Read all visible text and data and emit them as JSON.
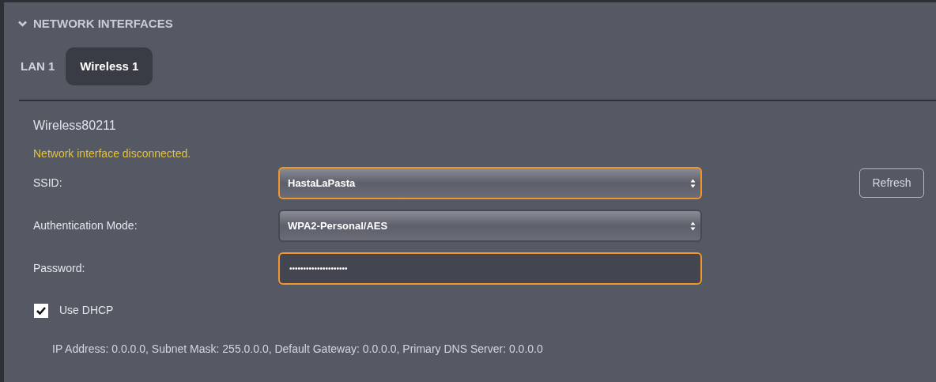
{
  "section": {
    "title": "NETWORK INTERFACES",
    "expanded": true
  },
  "tabs": [
    {
      "label": "LAN 1",
      "selected": false
    },
    {
      "label": "Wireless 1",
      "selected": true
    }
  ],
  "interface_name": "Wireless80211",
  "status_message": "Network interface disconnected.",
  "fields": [
    {
      "kind": "select",
      "label": "SSID:",
      "value": "HastaLaPasta",
      "focused": true
    },
    {
      "kind": "select",
      "label": "Authentication Mode:",
      "value": "WPA2-Personal/AES",
      "focused": false
    },
    {
      "kind": "password",
      "label": "Password:",
      "value": "•••••••••••••••••••••",
      "focused": true
    }
  ],
  "refresh_button": "Refresh",
  "dhcp": {
    "label": "Use DHCP",
    "checked": true
  },
  "ip_info": "IP Address: 0.0.0.0, Subnet Mask: 255.0.0.0, Default Gateway: 0.0.0.0, Primary DNS Server: 0.0.0.0"
}
